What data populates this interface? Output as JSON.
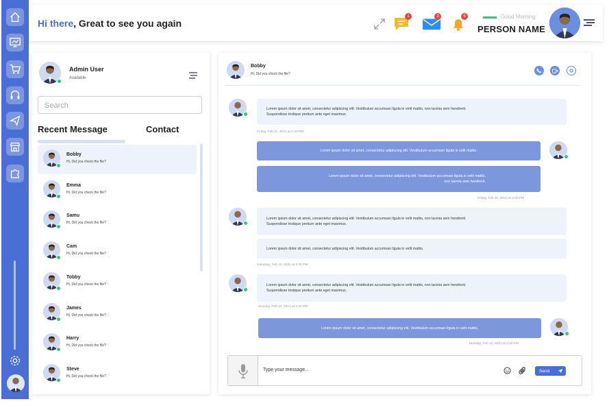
{
  "sidebar": {
    "icons": [
      "home-icon",
      "monitor-icon",
      "cart-icon",
      "headset-icon",
      "send-icon",
      "store-icon",
      "puzzle-icon"
    ],
    "bottom_icons": [
      "settings-icon",
      "user-avatar"
    ]
  },
  "header": {
    "greeting_hi": "Hi there",
    "greeting_rest": ", Great to see you again",
    "badges": {
      "chat": "1",
      "mail": "3",
      "bell": "6"
    },
    "good_morning": "Good Morning",
    "person_name": "PERSON NAME"
  },
  "left_panel": {
    "user_name": "Admin User",
    "user_status": "Available",
    "search_placeholder": "Search",
    "tab_recent": "Recent Message",
    "tab_contact": "Contact",
    "contacts": [
      {
        "name": "Bobby",
        "message": "Hi, Did you check the file?",
        "active": true
      },
      {
        "name": "Emma",
        "message": "Hi, Did you check the file?"
      },
      {
        "name": "Samu",
        "message": "Hi, Did you check the file?"
      },
      {
        "name": "Cam",
        "message": "Hi, Did you check the file?"
      },
      {
        "name": "Tobby",
        "message": "Hi, Did you check the file?"
      },
      {
        "name": "James",
        "message": "Hi, Did you check the file?"
      },
      {
        "name": "Harry",
        "message": "Hi, Did you check the file?"
      },
      {
        "name": "Steve",
        "message": "Hi, Did you check the file?"
      }
    ]
  },
  "chat": {
    "contact_name": "Bobby",
    "contact_message": "Hi, Did you check the file?",
    "messages": [
      {
        "line1": "Lorem ipsum dolor sit amet, consectetur adipiscing elit. Vestibulum accumsan ligula in velit mattis, non lacinia sem hendrerit.",
        "line2": "Suspendisse tristique pretium ante eget maximus."
      },
      {
        "line1": "Lorem ipsum dolor sit amet, consectetur adipiscing elit. Vestibulum accumsan ligula in velit mattis."
      },
      {
        "line1": "Lorem ipsum dolor sit amet, consectetur adipiscing elit. Vestibulum accumsan ligula in velit mattis,",
        "line2": "non lacinia sem hendrerit."
      },
      {
        "line1": "Lorem ipsum dolor sit amet, consectetur adipiscing elit. Vestibulum accumsan ligula in velit mattis, non lacinia sem hendrerit.",
        "line2": "Suspendisse tristique pretium ante eget maximus."
      },
      {
        "line1": "Lorem ipsum dolor sit amet, consectetur adipiscing elit. Vestibulum accumsan ligula in velit mattis."
      },
      {
        "line1": "Lorem ipsum dolor sit amet, consectetur adipiscing elit. Vestibulum accumsan ligula in velit mattis, non lacinia sem hendrerit.",
        "line2": "Suspendisse tristique pretium ante eget maximus."
      },
      {
        "line1": "Lorem ipsum dolor sit amet, consectetur adipiscing elit. Vestibulum accumsan ligula in velit mattis."
      }
    ],
    "timestamps": [
      "Friday, Feb 11, 2021 at 2:30 PM",
      "Friday, Feb 11, 2021 at 2:40 PM",
      "Saturday, Feb 12, 2021 at 6:30 PM",
      "Monday, Feb 14, 2021 at 2:32 PM",
      "Monday, Feb 14, 2021 at 2:40 PM"
    ],
    "composer_placeholder": "Type your message...",
    "send_label": "Send"
  },
  "colors": {
    "brand": "#4a6fd4",
    "bubble_out": "#7d97dc",
    "bubble_in": "#eef2fa",
    "online": "#2ecc71",
    "badge": "#e64545"
  }
}
